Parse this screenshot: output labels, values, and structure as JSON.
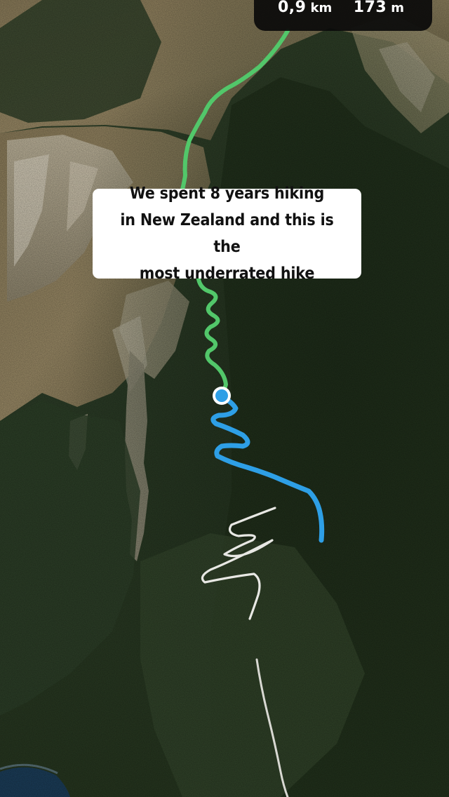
{
  "stats": {
    "distance_value": "0,9",
    "distance_unit": "km",
    "elevation_value": "173",
    "elevation_unit": "m"
  },
  "caption": {
    "text": "We spent 8 years hiking\nin New Zealand and this is the\nmost underrated hike"
  },
  "route": {
    "completed_color": "#52c76a",
    "upcoming_color": "#2e9fe6",
    "position_marker_color": "#2e9fe6"
  }
}
